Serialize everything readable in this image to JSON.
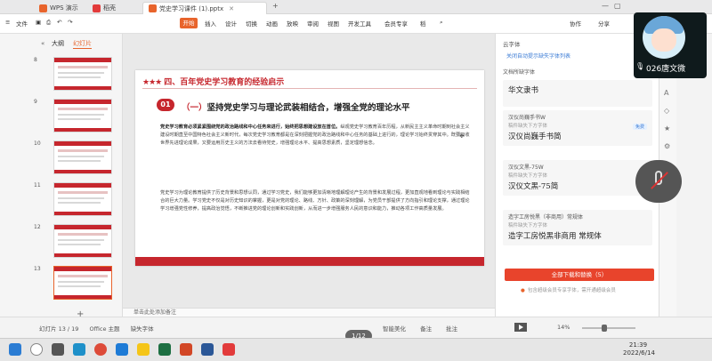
{
  "tabs": [
    {
      "label": "WPS 演示",
      "color": "#e8642c"
    },
    {
      "label": "稻壳",
      "color": "#e23b3b"
    },
    {
      "label": "党史学习课件 (1).pptx",
      "color": "#e8642c"
    }
  ],
  "menu": {
    "file": "文件",
    "start": "开始",
    "items": [
      "插入",
      "设计",
      "切换",
      "动画",
      "放映",
      "审阅",
      "视图",
      "开发工具",
      "会员专享",
      "稻"
    ],
    "share": "分享",
    "collab": "协作"
  },
  "left_panel": {
    "tab_outline": "大纲",
    "tab_slides": "幻灯片",
    "slide_numbers": [
      "8",
      "9",
      "10",
      "11",
      "12",
      "13"
    ],
    "selected_index": 5
  },
  "slide": {
    "header": "四、百年党史学习教育的经验启示",
    "stars": "★★★",
    "badge": "01",
    "title_paren": "（一）",
    "title": "坚持党史学习与理论武装相结合，增强全党的理论水平",
    "para1_bold": "党史学习教育必须紧紧围绕党的政治路线和中心任务来进行，始终把思想建设放在首位。",
    "para1": "纵观党史学习教育百年历程，从新民主主义革命时期到社会主义建设时期直至中国特色社会主义新时代，每次党史学习教育都是在深刻把握党的政治路线和中心任务的基础上进行的，理论学习始终贯穿其中。既要吸收世界先进理论成果，又要运用历史主义的方法去看待党史，增强理论水平、提高思想素质，坚定理想信念。",
    "para2": "党史学习为理论教育提供了历史背景和思想认同，通过学习党史，我们能够更加清晰地理解理论产生的背景和发展过程，更加直观地看到理论与实践相结合的巨大力量。学习党史不仅是对历史知识的掌握，更是对党的理论、路线、方针、政策的深刻理解，为党员干部提供了方向指引和理论支撑，通过理论学习增强党性修养，提高政治觉悟，不断推进党的理论创新和实践创新，从而进一步增强服务人民的意识和能力，推动各项工作高质量发展。"
  },
  "notes_placeholder": "单击此处添加备注",
  "font_panel": {
    "title": "云字体",
    "link": "关闭自动提示缺失字体列表",
    "section1": "文档所缺字体",
    "fonts": [
      {
        "name": "",
        "sub": "",
        "sample": "华文隶书"
      },
      {
        "name": "汉仪尚巍手书W",
        "sub": "稿件缺失下方字体",
        "sample": "汉仪尚巍手书简",
        "tag": "免费"
      },
      {
        "name": "汉仪文黑-75W",
        "sub": "稿件缺失下方字体",
        "sample": "汉仪文黑-75简"
      },
      {
        "name": "造字工房悦黑（非商用）常规体",
        "sub": "稿件缺失下方字体",
        "sample": "造字工房悦黑非商用 常规体"
      }
    ],
    "download_all": "全部下载和替换（5）",
    "vip_note": "包含超级会员专享字体，需开通超级会员"
  },
  "cam": {
    "name": "026唐文微"
  },
  "status": {
    "slide_info": "幻灯片 13 / 19",
    "theme": "Office 主题",
    "missing_font": "缺失字体",
    "pager": "1/12",
    "smart": "智能美化",
    "notes": "备注",
    "comment": "批注",
    "zoom": "14%"
  },
  "clock": {
    "time": "21:39",
    "date": "2022/6/14"
  }
}
